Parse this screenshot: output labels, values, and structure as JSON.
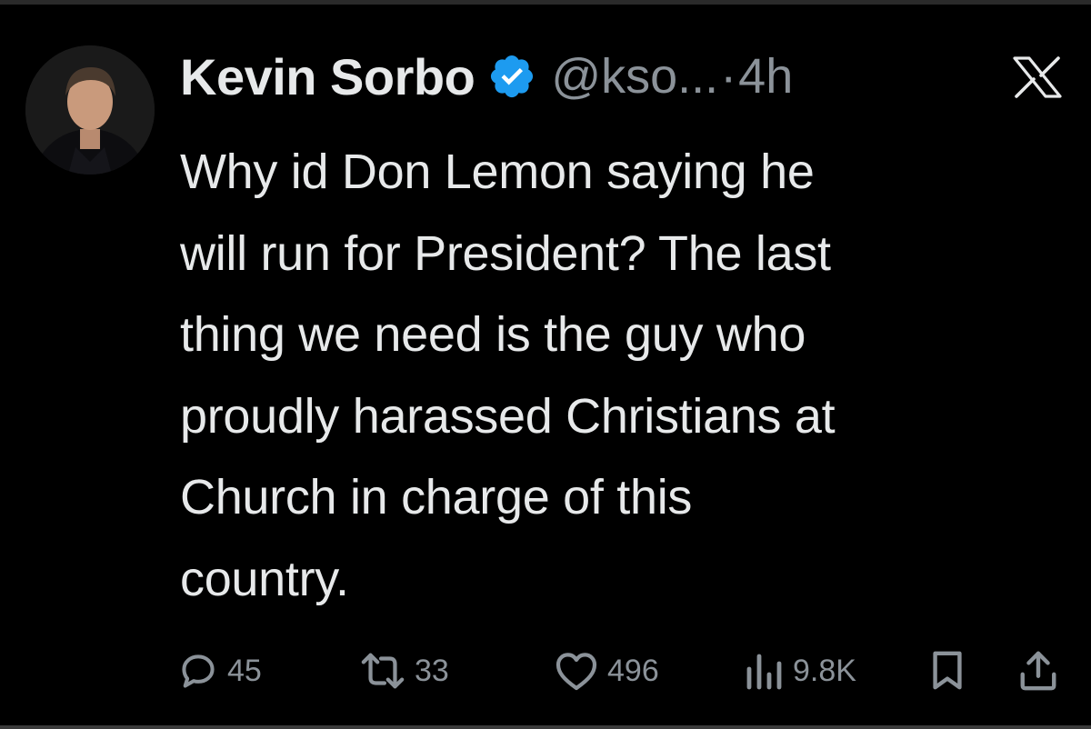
{
  "author": {
    "name": "Kevin Sorbo",
    "handle": "@kso...",
    "separator": "·",
    "time": "4h",
    "verified_color": "#1d9bf0"
  },
  "platform_icon": "x-logo-icon",
  "tweet": {
    "text": "Why id Don Lemon saying he\nwill run for President? The last\nthing we need is the guy who\nproudly harassed Christians at\nChurch in charge of this\ncountry."
  },
  "actions": {
    "replies": "45",
    "reposts": "33",
    "likes": "496",
    "views": "9.8K"
  },
  "colors": {
    "background": "#000000",
    "text": "#e7e9ea",
    "secondary": "#8b9299",
    "accent": "#1d9bf0"
  }
}
